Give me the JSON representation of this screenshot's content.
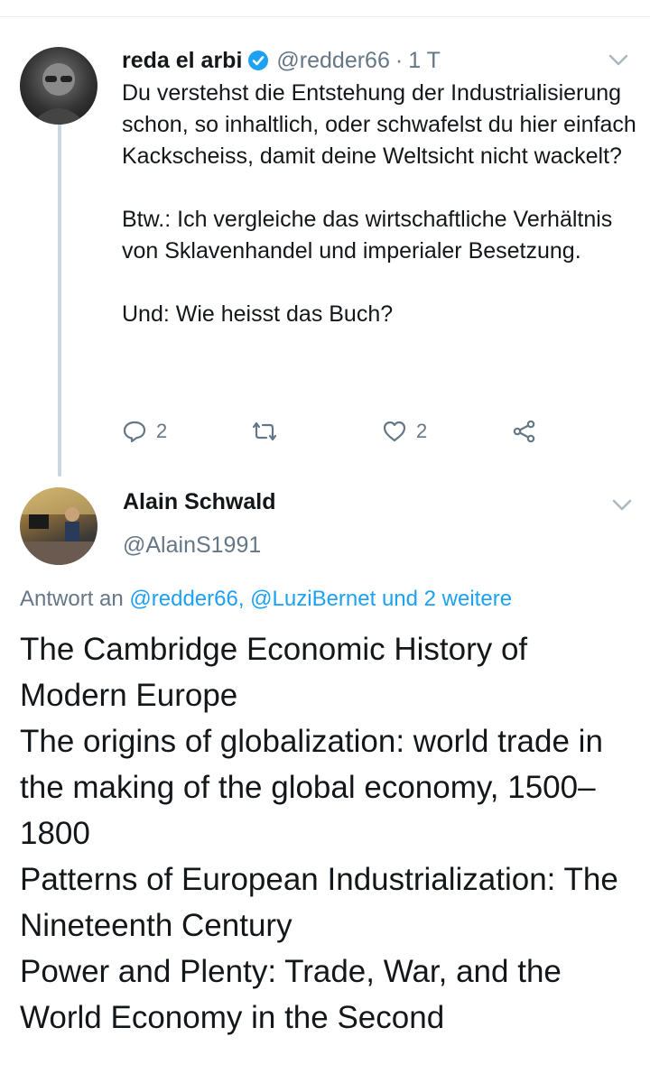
{
  "tweet1": {
    "name": "reda el arbi",
    "handle": "@redder66",
    "separator": "·",
    "time": "1 T",
    "paragraphs": [
      "Du verstehst die Entstehung der Industrialisierung schon, so inhaltlich, oder schwafelst du hier einfach Kackscheiss, damit deine Weltsicht nicht wackelt?",
      "Btw.: Ich vergleiche das wirtschaftliche Verhältnis von Sklavenhandel und imperialer Besetzung.",
      "Und: Wie heisst das Buch?"
    ],
    "reply_count": "2",
    "like_count": "2"
  },
  "tweet2": {
    "name": "Alain Schwald",
    "handle": "@AlainS1991",
    "reply_prefix": "Antwort an",
    "reply_targets": "@redder66, @LuziBernet und 2 weitere",
    "lines": [
      "The Cambridge Economic History of Modern Europe",
      "The origins of globalization: world trade in the making of the global economy, 1500–1800",
      "Patterns of European Industrialization: The Nineteenth Century",
      "Power and Plenty: Trade, War, and the World Economy in the Second"
    ]
  },
  "icons": {
    "verified": "verified-badge-icon",
    "more": "chevron-down-icon",
    "reply": "reply-icon",
    "retweet": "retweet-icon",
    "like": "heart-icon",
    "share": "share-icon"
  },
  "colors": {
    "link": "#1da1f2",
    "secondary_text": "#657786",
    "thread_line": "#ccd6dd"
  }
}
